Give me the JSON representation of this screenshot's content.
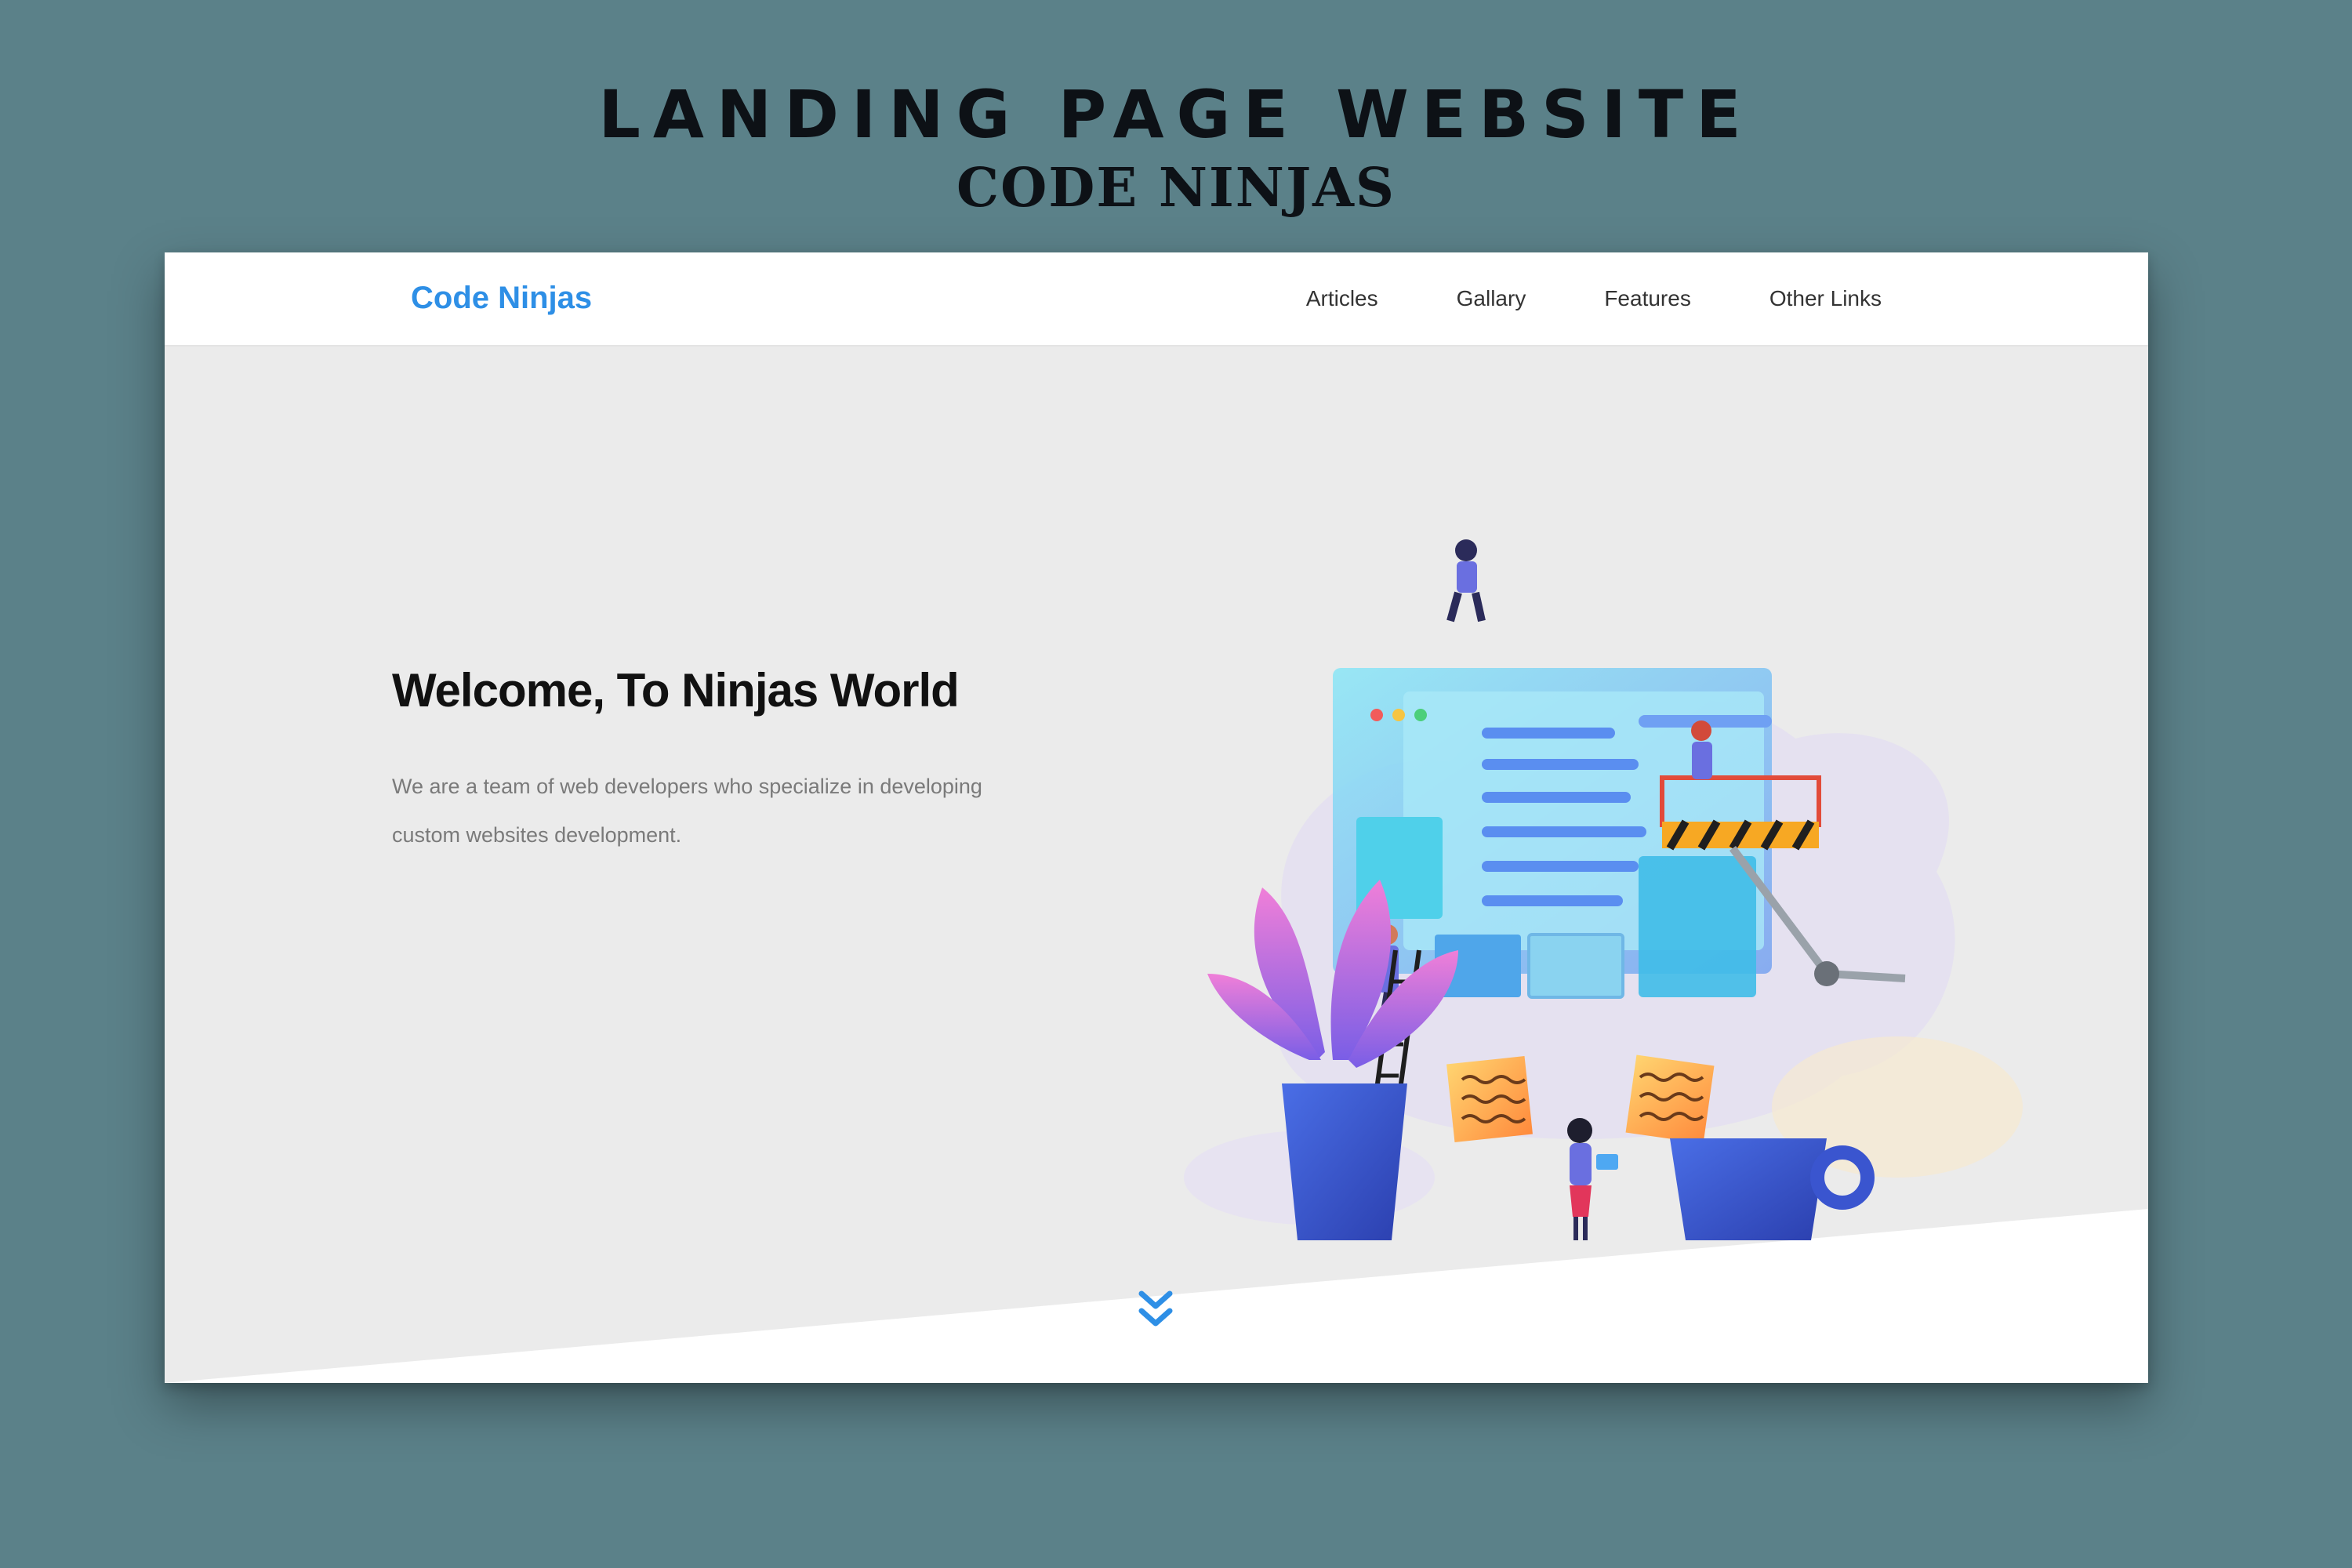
{
  "poster": {
    "title": "LANDING PAGE WEBSITE",
    "subtitle": "CODE NINJAS"
  },
  "navbar": {
    "brand": "Code Ninjas",
    "links": [
      "Articles",
      "Gallary",
      "Features",
      "Other Links"
    ]
  },
  "hero": {
    "heading": "Welcome, To Ninjas World",
    "description": "We are a team of web developers who specialize in developing custom websites development."
  },
  "icons": {
    "scroll": "double-chevron-down-icon"
  },
  "colors": {
    "brand": "#2e8fe6",
    "background": "#5b8189",
    "hero_bg": "#ebebeb"
  }
}
